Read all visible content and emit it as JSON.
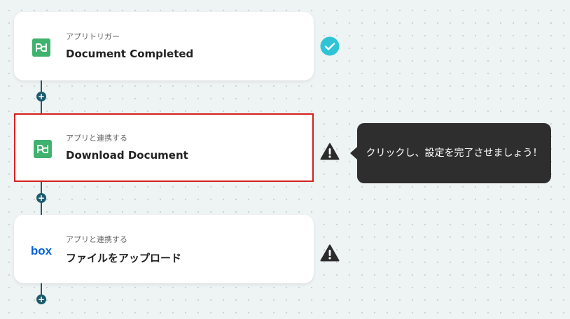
{
  "flow": {
    "steps": [
      {
        "subtitle": "アプリトリガー",
        "title": "Document Completed",
        "app": "pandadoc",
        "status": "complete"
      },
      {
        "subtitle": "アプリと連携する",
        "title": "Download Document",
        "app": "pandadoc",
        "status": "warning",
        "selected": true
      },
      {
        "subtitle": "アプリと連携する",
        "title": "ファイルをアップロード",
        "app": "box",
        "status": "warning"
      }
    ],
    "box_logo_text": "box"
  },
  "tooltip": {
    "text": "クリックし、設定を完了させましょう！"
  },
  "colors": {
    "connector": "#1d5a6e",
    "check": "#2ec4d6",
    "warning": "#2b2b2b",
    "selected_border": "#d61f1f",
    "pandadoc": "#3fb26e",
    "box": "#0061d5"
  },
  "icons": {
    "complete": "check-circle-icon",
    "warning": "warning-triangle-icon",
    "add": "plus-icon"
  }
}
